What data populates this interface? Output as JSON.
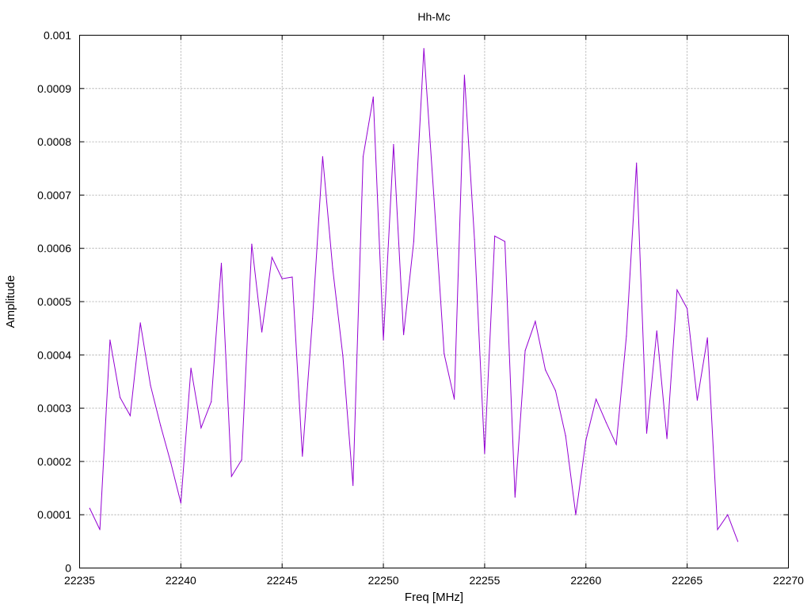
{
  "chart_data": {
    "type": "line",
    "title": "Hh-Mc",
    "xlabel": "Freq [MHz]",
    "ylabel": "Amplitude",
    "xlim": [
      22235,
      22270
    ],
    "ylim": [
      0,
      0.001
    ],
    "grid": true,
    "x_ticks": [
      "22235",
      "22240",
      "22245",
      "22250",
      "22255",
      "22260",
      "22265",
      "22270"
    ],
    "y_ticks": [
      "0",
      "0.0001",
      "0.0002",
      "0.0003",
      "0.0004",
      "0.0005",
      "0.0006",
      "0.0007",
      "0.0008",
      "0.0009",
      "0.001"
    ],
    "series": [
      {
        "color": "#9400d3",
        "x": [
          22235.5,
          22236.0,
          22236.5,
          22237.0,
          22237.5,
          22238.0,
          22238.5,
          22239.0,
          22239.5,
          22240.0,
          22240.5,
          22241.0,
          22241.5,
          22242.0,
          22242.5,
          22243.0,
          22243.5,
          22244.0,
          22244.5,
          22245.0,
          22245.5,
          22246.0,
          22246.5,
          22247.0,
          22247.5,
          22248.0,
          22248.5,
          22249.0,
          22249.5,
          22250.0,
          22250.5,
          22251.0,
          22251.5,
          22252.0,
          22252.5,
          22253.0,
          22253.5,
          22254.0,
          22254.5,
          22255.0,
          22255.5,
          22256.0,
          22256.5,
          22257.0,
          22257.5,
          22258.0,
          22258.5,
          22259.0,
          22259.5,
          22260.0,
          22260.5,
          22261.0,
          22261.5,
          22262.0,
          22262.5,
          22263.0,
          22263.5,
          22264.0,
          22264.5,
          22265.0,
          22265.5,
          22266.0,
          22266.5,
          22267.0,
          22267.5
        ],
        "y": [
          0.000112,
          7.2e-05,
          0.000428,
          0.00032,
          0.000286,
          0.00046,
          0.000343,
          0.000267,
          0.000198,
          0.000122,
          0.000375,
          0.000263,
          0.000312,
          0.000572,
          0.000172,
          0.000203,
          0.000608,
          0.000443,
          0.000583,
          0.000543,
          0.000546,
          0.00021,
          0.000468,
          0.000772,
          0.000562,
          0.000398,
          0.000155,
          0.000772,
          0.000884,
          0.000428,
          0.000795,
          0.000438,
          0.000613,
          0.000975,
          0.000693,
          0.000402,
          0.000317,
          0.000925,
          0.000617,
          0.000215,
          0.000623,
          0.000613,
          0.000133,
          0.000408,
          0.000463,
          0.000372,
          0.000333,
          0.000248,
          0.0001,
          0.00024,
          0.000317,
          0.000273,
          0.000232,
          0.000435,
          0.00076,
          0.000253,
          0.000445,
          0.000243,
          0.000522,
          0.000487,
          0.000315,
          0.000432,
          7.2e-05,
          0.0001,
          5e-05
        ]
      }
    ]
  }
}
